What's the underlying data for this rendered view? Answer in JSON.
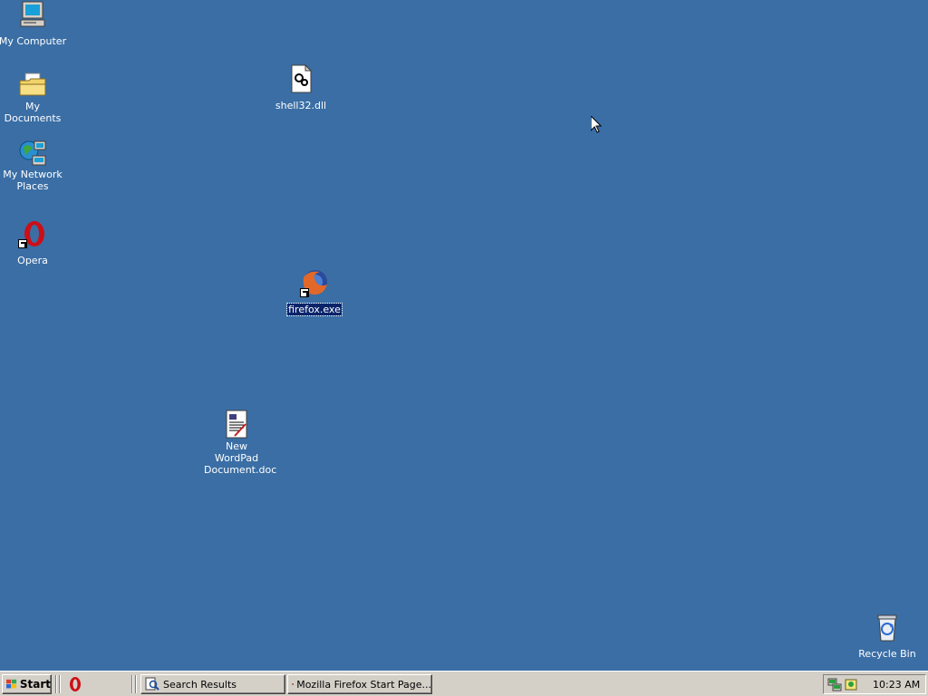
{
  "desktop": {
    "background": "#3a6ea5",
    "icons": [
      {
        "label": "My Computer",
        "icon": "computer-icon"
      },
      {
        "label": "My Documents",
        "icon": "documents-folder-icon"
      },
      {
        "label": "My Network Places",
        "icon": "network-places-icon"
      },
      {
        "label": "Opera",
        "icon": "opera-icon",
        "shortcut": true
      },
      {
        "label": "shell32.dll",
        "icon": "dll-file-icon"
      },
      {
        "label": "firefox.exe",
        "icon": "firefox-icon",
        "shortcut": true,
        "selected": true
      },
      {
        "label": "New WordPad Document.doc",
        "icon": "wordpad-doc-icon"
      },
      {
        "label": "Recycle Bin",
        "icon": "recycle-bin-icon"
      }
    ]
  },
  "taskbar": {
    "start_label": "Start",
    "quicklaunch": [
      {
        "icon": "opera-icon"
      }
    ],
    "tasks": [
      {
        "label": "Search Results",
        "icon": "search-icon"
      },
      {
        "label": "Mozilla Firefox Start Page...",
        "icon": "firefox-icon"
      }
    ],
    "tray_icons": [
      "network-icon",
      "security-icon"
    ],
    "clock": "10:23 AM"
  }
}
